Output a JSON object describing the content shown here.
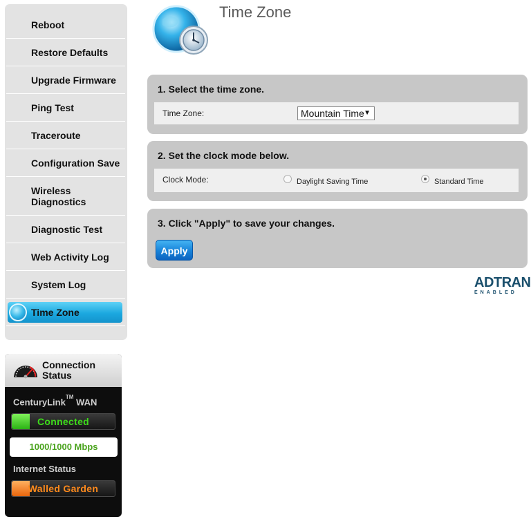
{
  "sidebar": {
    "items": [
      {
        "label": "Reboot"
      },
      {
        "label": "Restore Defaults"
      },
      {
        "label": "Upgrade Firmware"
      },
      {
        "label": "Ping Test"
      },
      {
        "label": "Traceroute"
      },
      {
        "label": "Configuration Save"
      },
      {
        "label": "Wireless Diagnostics"
      },
      {
        "label": "Diagnostic Test"
      },
      {
        "label": "Web Activity Log"
      },
      {
        "label": "System Log"
      },
      {
        "label": "Time Zone",
        "active": true
      }
    ]
  },
  "connection": {
    "title": "Connection Status",
    "provider": "CenturyLink",
    "tm": "TM",
    "wan_label": "WAN",
    "wan_status": "Connected",
    "speed": "1000/1000 Mbps",
    "internet_label": "Internet Status",
    "internet_status": "Walled Garden",
    "colors": {
      "connected": "#3ddc1a",
      "walled": "#ff8a1c"
    }
  },
  "page": {
    "title": "Time Zone"
  },
  "step1": {
    "title": "1. Select the time zone.",
    "field_label": "Time Zone:",
    "selected": "Mountain Time"
  },
  "step2": {
    "title": "2. Set the clock mode below.",
    "field_label": "Clock Mode:",
    "option_dst": "Daylight Saving Time",
    "option_std": "Standard Time",
    "selected": "Standard Time"
  },
  "step3": {
    "title": "3. Click \"Apply\" to save your changes.",
    "apply_label": "Apply"
  },
  "logo": {
    "brand": "ADTRAN",
    "sub": "ENABLED"
  }
}
